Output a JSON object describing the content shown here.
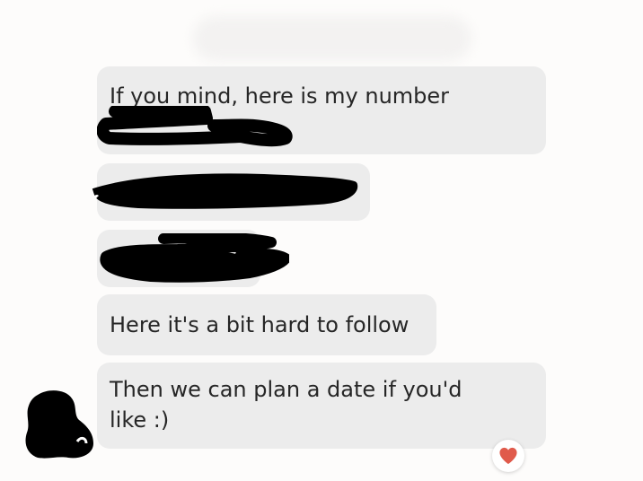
{
  "conversation": {
    "header": {
      "name_redacted": true
    },
    "messages": [
      {
        "id": "m1",
        "text": "If you mind, here is my number",
        "redacted_suffix": true
      },
      {
        "id": "m2",
        "text": "",
        "redacted": true
      },
      {
        "id": "m3",
        "text": "",
        "redacted": true
      },
      {
        "id": "m4",
        "text": "Here it's a bit hard to follow"
      },
      {
        "id": "m5",
        "text": "Then we can plan a date if you'd\nlike :)"
      }
    ],
    "reaction": {
      "icon": "heart-icon",
      "color": "#e05a4b"
    },
    "avatar": {
      "redacted": true
    }
  }
}
